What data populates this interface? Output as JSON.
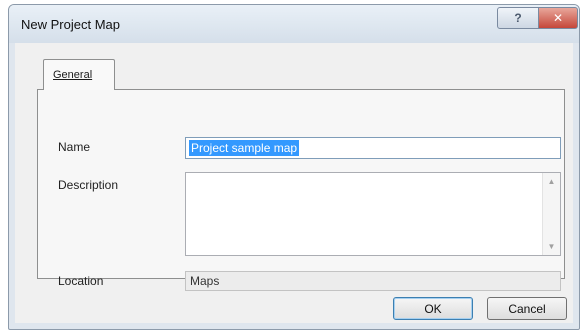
{
  "dialog": {
    "title": "New Project Map",
    "help_glyph": "?",
    "close_glyph": "✕"
  },
  "tabs": [
    {
      "label": "General",
      "selected": true
    }
  ],
  "form": {
    "name_label": "Name",
    "name_value": "Project sample map",
    "description_label": "Description",
    "description_value": "",
    "location_label": "Location",
    "location_value": "Maps"
  },
  "icons": {
    "help": "help-icon",
    "close": "close-icon",
    "scroll_up": "scroll-up-icon",
    "scroll_down": "scroll-down-icon"
  },
  "buttons": {
    "ok_label": "OK",
    "cancel_label": "Cancel"
  },
  "colors": {
    "selection": "#3399ff",
    "close_button": "#c5473a",
    "dialog_frame": "#dfe6ee"
  }
}
